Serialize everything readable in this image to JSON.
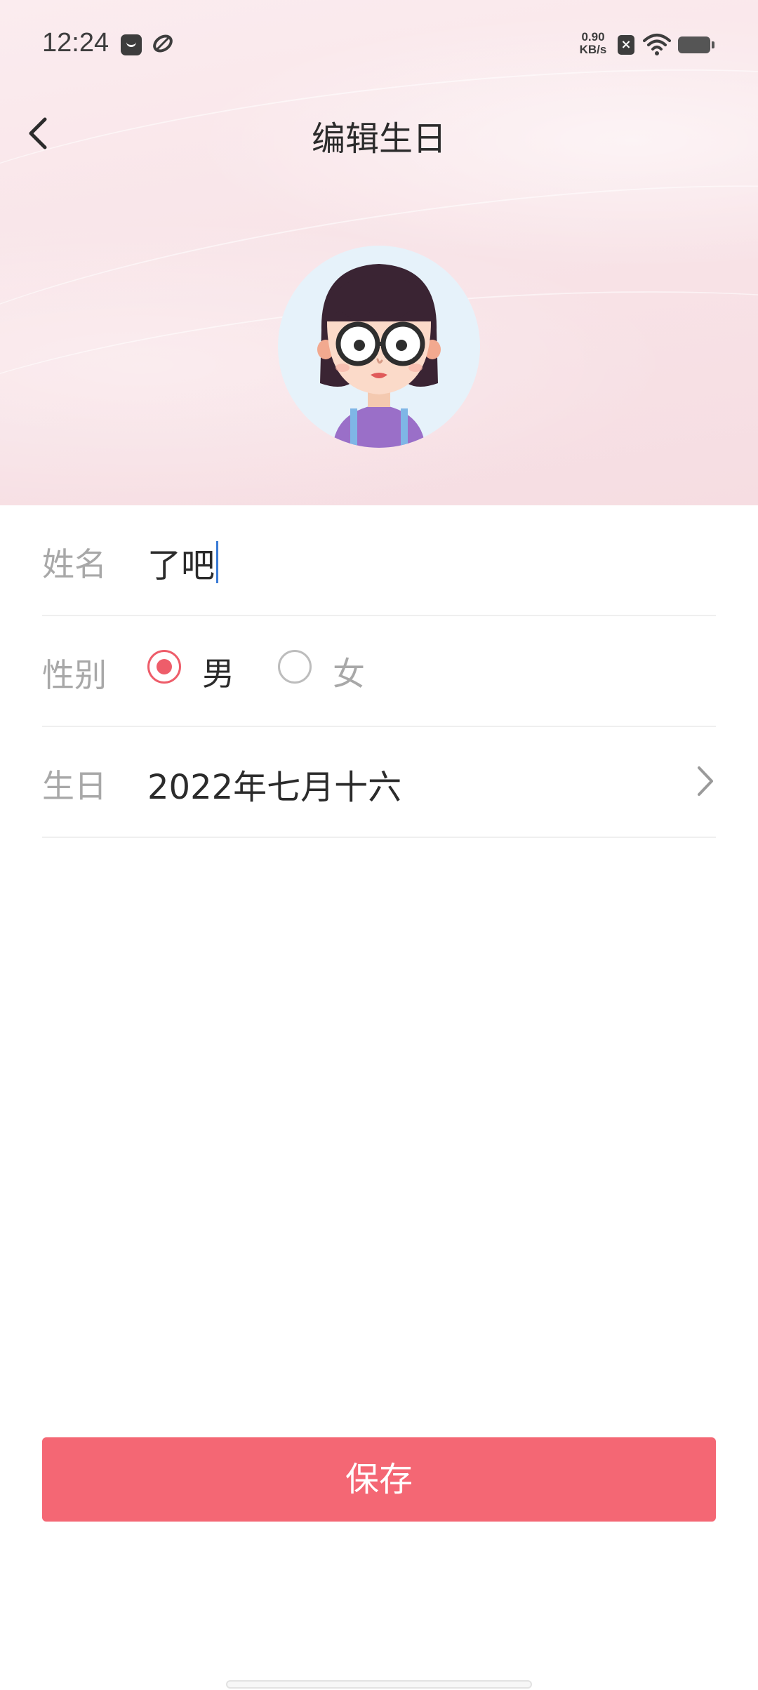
{
  "status_bar": {
    "time": "12:24",
    "net_speed_value": "0.90",
    "net_speed_unit": "KB/s",
    "icons": [
      "notification-app-icon",
      "sync-app-icon",
      "sim-disabled-icon",
      "wifi-icon",
      "battery-icon"
    ]
  },
  "nav": {
    "back_icon": "chevron-left-icon",
    "title": "编辑生日"
  },
  "avatar": {
    "icon": "girl-with-glasses-avatar"
  },
  "form": {
    "name": {
      "label": "姓名",
      "value": "了吧"
    },
    "gender": {
      "label": "性别",
      "options": [
        {
          "label": "男",
          "selected": true
        },
        {
          "label": "女",
          "selected": false
        }
      ]
    },
    "birthday": {
      "label": "生日",
      "value": "2022年七月十六",
      "icon": "chevron-right-icon"
    }
  },
  "actions": {
    "save_label": "保存"
  },
  "colors": {
    "accent": "#f46774",
    "radio_selected": "#ee5d6a",
    "header_bg": "#f8e3e7",
    "label_gray": "#a8a8a8",
    "text_dark": "#2b2b2b"
  }
}
